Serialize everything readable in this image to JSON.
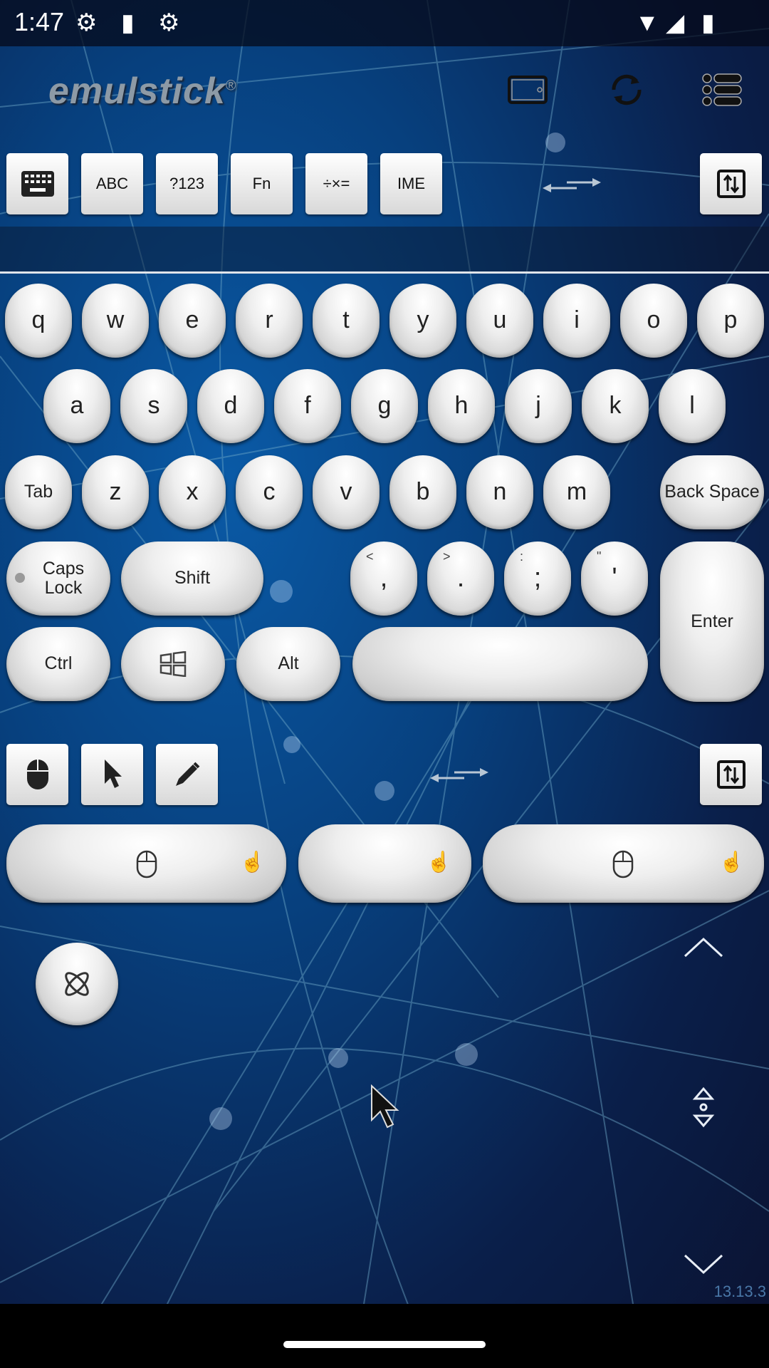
{
  "status_bar": {
    "time": "1:47",
    "icons": [
      "settings-gear-icon",
      "sd-card-icon",
      "settings-gear-icon",
      "wifi-icon",
      "signal-icon",
      "battery-icon"
    ]
  },
  "header": {
    "logo": "emulstick",
    "registered": "®",
    "icons": [
      "tablet-icon",
      "sync-icon",
      "menu-list-icon"
    ]
  },
  "toolbar": {
    "buttons": [
      {
        "icon": "keyboard-icon",
        "label": ""
      },
      {
        "label": "ABC"
      },
      {
        "label": "?123"
      },
      {
        "label": "Fn"
      },
      {
        "label": "÷×="
      },
      {
        "label": "IME"
      }
    ],
    "swap_icon": "swap-arrows-icon",
    "toggle_icon": "swap-vertical-icon"
  },
  "text_input": {
    "value": ""
  },
  "keyboard": {
    "row1": [
      "q",
      "w",
      "e",
      "r",
      "t",
      "y",
      "u",
      "i",
      "o",
      "p"
    ],
    "row2": [
      "a",
      "s",
      "d",
      "f",
      "g",
      "h",
      "j",
      "k",
      "l"
    ],
    "row3": [
      "Tab",
      "z",
      "x",
      "c",
      "v",
      "b",
      "n",
      "m"
    ],
    "backspace": "Back Space",
    "caps": "Caps Lock",
    "shift": "Shift",
    "punct": [
      {
        "main": ",",
        "sub": "<"
      },
      {
        "main": ".",
        "sub": ">"
      },
      {
        "main": ";",
        "sub": ":"
      },
      {
        "main": "'",
        "sub": "\""
      }
    ],
    "enter": "Enter",
    "ctrl": "Ctrl",
    "alt": "Alt",
    "win_icon": "windows-icon"
  },
  "mouse_toolbar": {
    "icons": [
      "mouse-icon",
      "pointer-icon",
      "pencil-icon",
      "swap-arrows-icon",
      "swap-vertical-icon"
    ]
  },
  "mouse_buttons": [
    "left",
    "middle",
    "right"
  ],
  "version": "13.13.3",
  "colors": {
    "key_face": "#eeeeee",
    "background": "#07407e"
  }
}
